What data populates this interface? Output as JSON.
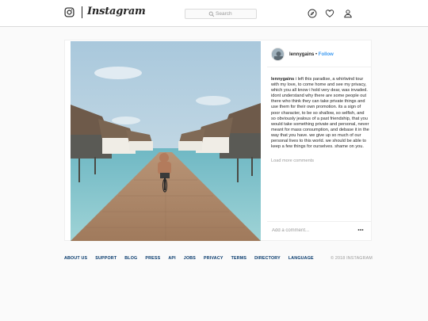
{
  "header": {
    "wordmark": "Instagram",
    "search": {
      "placeholder": "Search"
    },
    "nav_icons": [
      "compass-icon",
      "heart-icon",
      "profile-icon"
    ]
  },
  "post": {
    "username": "lennygains",
    "separator": "•",
    "follow_label": "Follow",
    "caption_username": "lennygains",
    "caption_text": "i left this paradise, a whirlwind tour with my love, to come home and see my privacy, which you all know i hold very dear, was invaded. idont understand why there are some people out there who think they can take private things and use them for their own promotion. its a sign of poor character, to be so shallow, so selfish, and so obviously jealous of a past friendship, that you would take something private and personal, never meant for mass consumption, and debase it in the way that you have. we give up so much of our personal lives to this world. we should be able to keep a few things for ourselves. shame on you.",
    "load_more": "Load more comments",
    "comment_placeholder": "Add a comment...",
    "more_icon": "more-options-icon"
  },
  "footer": {
    "links": [
      "ABOUT US",
      "SUPPORT",
      "BLOG",
      "PRESS",
      "API",
      "JOBS",
      "PRIVACY",
      "TERMS",
      "DIRECTORY",
      "LANGUAGE"
    ],
    "copyright": "© 2018 INSTAGRAM"
  },
  "colors": {
    "follow": "#3897f0",
    "footer_link": "#003569",
    "border": "#dbdbdb",
    "background": "#fafafa"
  }
}
